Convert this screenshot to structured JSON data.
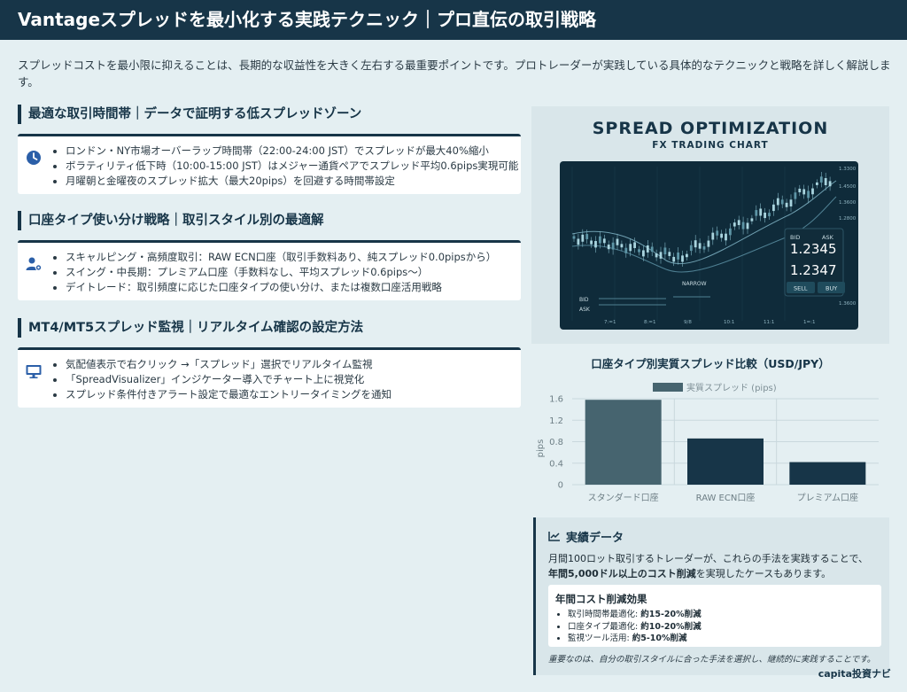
{
  "header": {
    "title": "Vantageスプレッドを最小化する実践テクニック｜プロ直伝の取引戦略"
  },
  "intro": "スプレッドコストを最小限に抑えることは、長期的な収益性を大きく左右する最重要ポイントです。プロトレーダーが実践している具体的なテクニックと戦略を詳しく解説します。",
  "sections": [
    {
      "title": "最適な取引時間帯｜データで証明する低スプレッドゾーン",
      "icon": "clock-icon",
      "items": [
        "ロンドン・NY市場オーバーラップ時間帯（22:00-24:00 JST）でスプレッドが最大40%縮小",
        "ボラティリティ低下時（10:00-15:00 JST）はメジャー通貨ペアでスプレッド平均0.6pips実現可能",
        "月曜朝と金曜夜のスプレッド拡大（最大20pips）を回避する時間帯設定"
      ]
    },
    {
      "title": "口座タイプ使い分け戦略｜取引スタイル別の最適解",
      "icon": "user-gear-icon",
      "items": [
        "スキャルピング・高頻度取引：RAW ECN口座（取引手数料あり、純スプレッド0.0pipsから）",
        "スイング・中長期：プレミアム口座（手数料なし、平均スプレッド0.6pips〜）",
        "デイトレード：取引頻度に応じた口座タイプの使い分け、または複数口座活用戦略"
      ]
    },
    {
      "title": "MT4/MT5スプレッド監視｜リアルタイム確認の設定方法",
      "icon": "monitor-icon",
      "items": [
        "気配値表示で右クリック →「スプレッド」選択でリアルタイム監視",
        "「SpreadVisualizer」インジケーター導入でチャート上に視覚化",
        "スプレッド条件付きアラート設定で最適なエントリータイミングを通知"
      ]
    }
  ],
  "illustration": {
    "title": "SPREAD OPTIMIZATION",
    "subtitle": "FX TRADING CHART",
    "bid_label": "BID",
    "ask_label": "ASK",
    "bid_price": "1.2345",
    "ask_price": "1.2347",
    "sell_label": "SELL",
    "buy_label": "BUY",
    "narrow_label": "NARROW",
    "left_bid": "BID",
    "left_ask": "ASK",
    "axis_ticks": [
      "1.3300",
      "1.4500",
      "1.3600",
      "1.2800",
      "1.3600"
    ],
    "x_ticks": [
      "7:=1",
      "8:=1",
      "9/8",
      "10:1",
      "11:1",
      "1=:1"
    ]
  },
  "chart_data": {
    "type": "bar",
    "title": "口座タイプ別実質スプレッド比較（USD/JPY）",
    "categories": [
      "スタンダード口座",
      "RAW ECN口座",
      "プレミアム口座"
    ],
    "series": [
      {
        "name": "実質スプレッド (pips)",
        "values": [
          1.58,
          0.86,
          0.42
        ]
      }
    ],
    "ylabel": "pips",
    "ylim": [
      0,
      1.6
    ],
    "yticks": [
      "0",
      "0.4",
      "0.8",
      "1.2",
      "1.6"
    ],
    "colors": [
      "#46646f",
      "#173548",
      "#173548"
    ],
    "legend": "top"
  },
  "stats": {
    "title": "実績データ",
    "line1": "月間100ロット取引するトレーダーが、これらの手法を実践することで、",
    "line2_bold": "年間5,000ドル以上のコスト削減",
    "line2_rest": "を実現したケースもあります。",
    "sub_title": "年間コスト削減効果",
    "items": [
      {
        "label": "取引時間帯最適化: ",
        "value": "約15-20%削減"
      },
      {
        "label": "口座タイプ最適化: ",
        "value": "約10-20%削減"
      },
      {
        "label": "監視ツール活用: ",
        "value": "約5-10%削減"
      }
    ],
    "note": "重要なのは、自分の取引スタイルに合った手法を選択し、継続的に実践することです。"
  },
  "brand": "capita投資ナビ"
}
